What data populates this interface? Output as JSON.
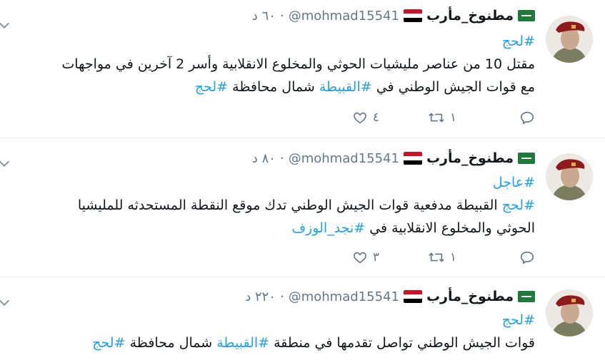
{
  "tweets": [
    {
      "name": "مطنوخ_مأرب",
      "handle": "@mohmad15541",
      "time": "٦٠ د",
      "line1": [
        {
          "t": "#لحج",
          "tag": true
        }
      ],
      "line2": [
        {
          "t": "مقتل 10 من عناصر مليشيات الحوثي والمخلوع الانقلابية وأسر 2 آخرين في مواجهات",
          "tag": false
        }
      ],
      "line3": [
        {
          "t": "مع قوات الجيش الوطني في ",
          "tag": false
        },
        {
          "t": "#القبيطة",
          "tag": true
        },
        {
          "t": " شمال محافظة ",
          "tag": false
        },
        {
          "t": "#لحج",
          "tag": true
        }
      ],
      "retweets": "١",
      "likes": "٤"
    },
    {
      "name": "مطنوخ_مأرب",
      "handle": "@mohmad15541",
      "time": "٨٠ د",
      "line1": [
        {
          "t": "#عاجل",
          "tag": true
        }
      ],
      "line2": [
        {
          "t": "#لحج",
          "tag": true
        },
        {
          "t": " القبيطة مدفعية قوات الجيش الوطني تدك موقع النقطة المستحدثه للمليشيا",
          "tag": false
        }
      ],
      "line3": [
        {
          "t": "الحوثي والمخلوع الانقلابية في ",
          "tag": false
        },
        {
          "t": "#نجد_الوزف",
          "tag": true
        }
      ],
      "retweets": "١",
      "likes": "٣"
    },
    {
      "name": "مطنوخ_مأرب",
      "handle": "@mohmad15541",
      "time": "٢٢٠ د",
      "line1": [
        {
          "t": "#لحج",
          "tag": true
        }
      ],
      "line2": [
        {
          "t": "قوات الجيش الوطني تواصل تقدمها في منطقة ",
          "tag": false
        },
        {
          "t": "#القبيطة",
          "tag": true
        },
        {
          "t": " شمال محافظة ",
          "tag": false
        },
        {
          "t": "#لحج",
          "tag": true
        }
      ],
      "line3": [],
      "retweets": "",
      "likes": ""
    }
  ],
  "icons": {
    "reply": "reply-icon",
    "retweet": "retweet-icon",
    "like": "heart-icon",
    "saudi_flag": "saudi-flag-icon",
    "yemen_flag": "yemen-flag-icon",
    "more": "chevron-down-icon"
  },
  "colors": {
    "link": "#1da1f2",
    "muted": "#657786",
    "text": "#14171a",
    "divider": "#e6ecf0",
    "saudi_green": "#1d7a3b",
    "yemen_red": "#ce1126",
    "yemen_black": "#000000"
  }
}
